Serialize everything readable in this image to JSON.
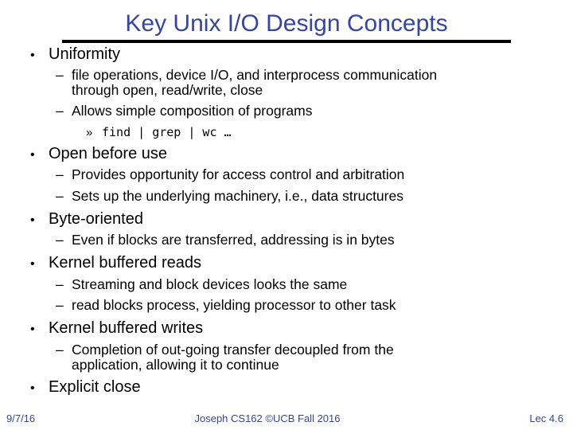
{
  "slide": {
    "title": "Key Unix I/O Design Concepts",
    "bullets": [
      {
        "label": "Uniformity",
        "subitems": [
          {
            "lines": [
              "file operations, device I/O, and interprocess communication",
              "through open, read/write, close"
            ]
          },
          {
            "lines": [
              "Allows simple composition of programs"
            ],
            "subsub": [
              {
                "marker": "»",
                "text": "find | grep | wc …"
              }
            ]
          }
        ]
      },
      {
        "label": "Open before use",
        "subitems": [
          {
            "lines": [
              "Provides opportunity for access control and arbitration"
            ]
          },
          {
            "lines": [
              "Sets up the underlying machinery, i.e., data structures"
            ]
          }
        ]
      },
      {
        "label": "Byte-oriented",
        "subitems": [
          {
            "lines": [
              "Even if blocks are transferred, addressing is in bytes"
            ]
          }
        ]
      },
      {
        "label": "Kernel buffered reads",
        "subitems": [
          {
            "lines": [
              "Streaming and block devices looks the same"
            ]
          },
          {
            "lines": [
              "read blocks process, yielding processor to other task"
            ]
          }
        ]
      },
      {
        "label": "Kernel buffered writes",
        "subitems": [
          {
            "lines": [
              "Completion of out-going transfer decoupled from the",
              "application, allowing it to continue"
            ]
          }
        ]
      },
      {
        "label": "Explicit close",
        "subitems": []
      }
    ],
    "bullet_marker": "•",
    "dash_marker": "–"
  },
  "footer": {
    "date": "9/7/16",
    "center": "Joseph CS162 ©UCB Fall 2016",
    "page": "Lec 4.6"
  },
  "colors": {
    "title": "#3344aa",
    "footer": "#3344aa",
    "text": "#000000",
    "rule": "#000000"
  }
}
